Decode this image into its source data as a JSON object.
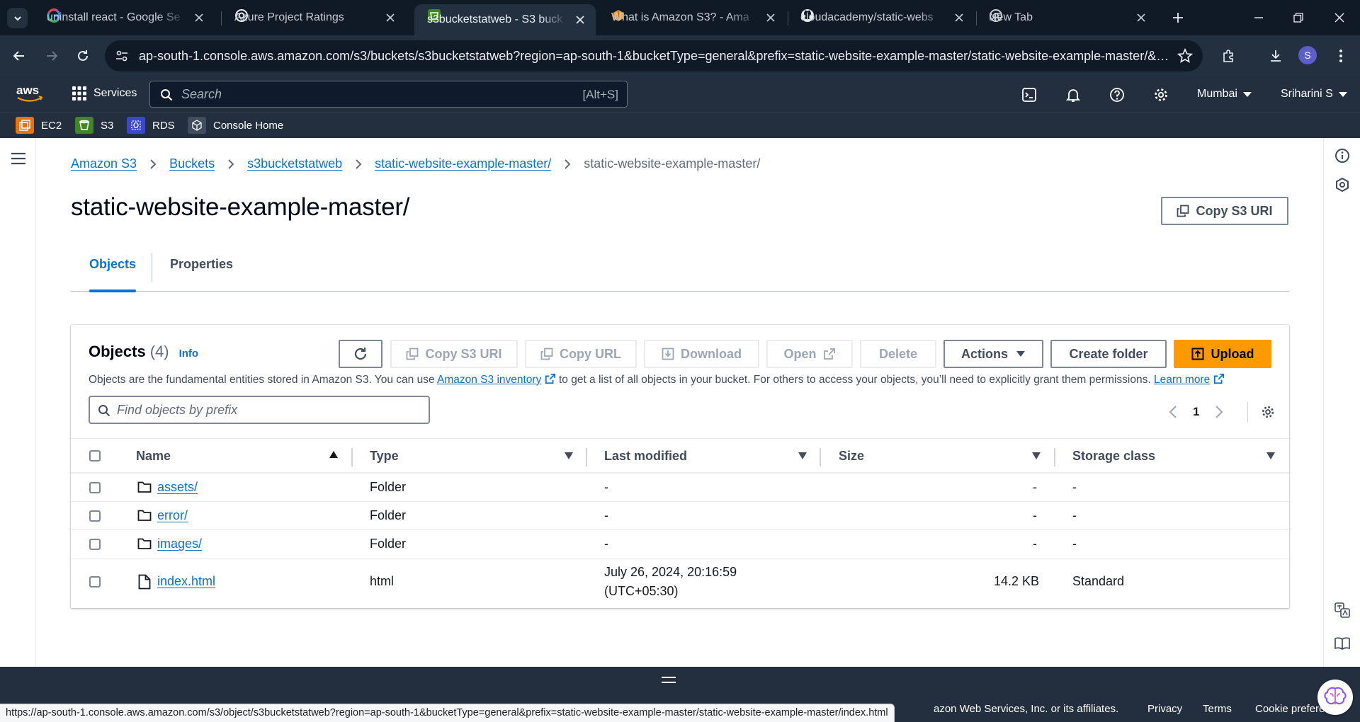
{
  "browser": {
    "tabs": [
      {
        "title": "uninstall react - Google Se",
        "favicon": "google-icon",
        "active": false
      },
      {
        "title": "Azure Project Ratings",
        "favicon": "chatgpt-icon",
        "active": false
      },
      {
        "title": "s3bucketstatweb - S3 buck",
        "favicon": "s3-icon",
        "active": true
      },
      {
        "title": "What is Amazon S3? - Ama",
        "favicon": "aws-docs-icon",
        "active": false
      },
      {
        "title": "cloudacademy/static-webs",
        "favicon": "github-icon",
        "active": false
      },
      {
        "title": "New Tab",
        "favicon": "chrome-icon",
        "active": false
      }
    ],
    "url": "ap-south-1.console.aws.amazon.com/s3/buckets/s3bucketstatweb?region=ap-south-1&bucketType=general&prefix=static-website-example-master/static-website-example-master/&sho...",
    "profile_initial": "S",
    "status_url": "https://ap-south-1.console.aws.amazon.com/s3/object/s3bucketstatweb?region=ap-south-1&bucketType=general&prefix=static-website-example-master/static-website-example-master/index.html"
  },
  "aws_header": {
    "logo": "aws",
    "services_label": "Services",
    "search_placeholder": "Search",
    "search_shortcut": "[Alt+S]",
    "region": "Mumbai",
    "user": "Sriharini S",
    "favorites": [
      {
        "label": "EC2",
        "color": "#ed7100"
      },
      {
        "label": "S3",
        "color": "#3f8624"
      },
      {
        "label": "RDS",
        "color": "#3b48cc"
      },
      {
        "label": "Console Home",
        "color": "#232f3e"
      }
    ]
  },
  "breadcrumbs": [
    "Amazon S3",
    "Buckets",
    "s3bucketstatweb",
    "static-website-example-master/",
    "static-website-example-master/"
  ],
  "page_title": "static-website-example-master/",
  "copy_s3_uri_label": "Copy S3 URI",
  "tabs": [
    "Objects",
    "Properties"
  ],
  "objects_panel": {
    "heading": "Objects",
    "count": "(4)",
    "info": "Info",
    "buttons": {
      "copy_s3_uri": "Copy S3 URI",
      "copy_url": "Copy URL",
      "download": "Download",
      "open": "Open",
      "delete": "Delete",
      "actions": "Actions",
      "create_folder": "Create folder",
      "upload": "Upload"
    },
    "description_pre": "Objects are the fundamental entities stored in Amazon S3. You can use",
    "inventory_link": "Amazon S3 inventory",
    "description_post": "to get a list of all objects in your bucket. For others to access your objects, you’ll need to explicitly grant them permissions.",
    "learn_more": "Learn more",
    "filter_placeholder": "Find objects by prefix",
    "page": "1",
    "columns": [
      "Name",
      "Type",
      "Last modified",
      "Size",
      "Storage class"
    ],
    "rows": [
      {
        "name": "assets/",
        "kind": "folder",
        "type": "Folder",
        "modified": "-",
        "size": "-",
        "storage": "-"
      },
      {
        "name": "error/",
        "kind": "folder",
        "type": "Folder",
        "modified": "-",
        "size": "-",
        "storage": "-"
      },
      {
        "name": "images/",
        "kind": "folder",
        "type": "Folder",
        "modified": "-",
        "size": "-",
        "storage": "-"
      },
      {
        "name": "index.html",
        "kind": "file",
        "type": "html",
        "modified": "July 26, 2024, 20:16:59",
        "modified_tz": "(UTC+05:30)",
        "size": "14.2 KB",
        "storage": "Standard"
      }
    ]
  },
  "footer": {
    "copyright_visible": "azon Web Services, Inc. or its affiliates.",
    "links": [
      "Privacy",
      "Terms",
      "Cookie preferen"
    ]
  },
  "colors": {
    "accent": "#0972d3",
    "upload": "#ff9900",
    "header": "#232f3e"
  }
}
